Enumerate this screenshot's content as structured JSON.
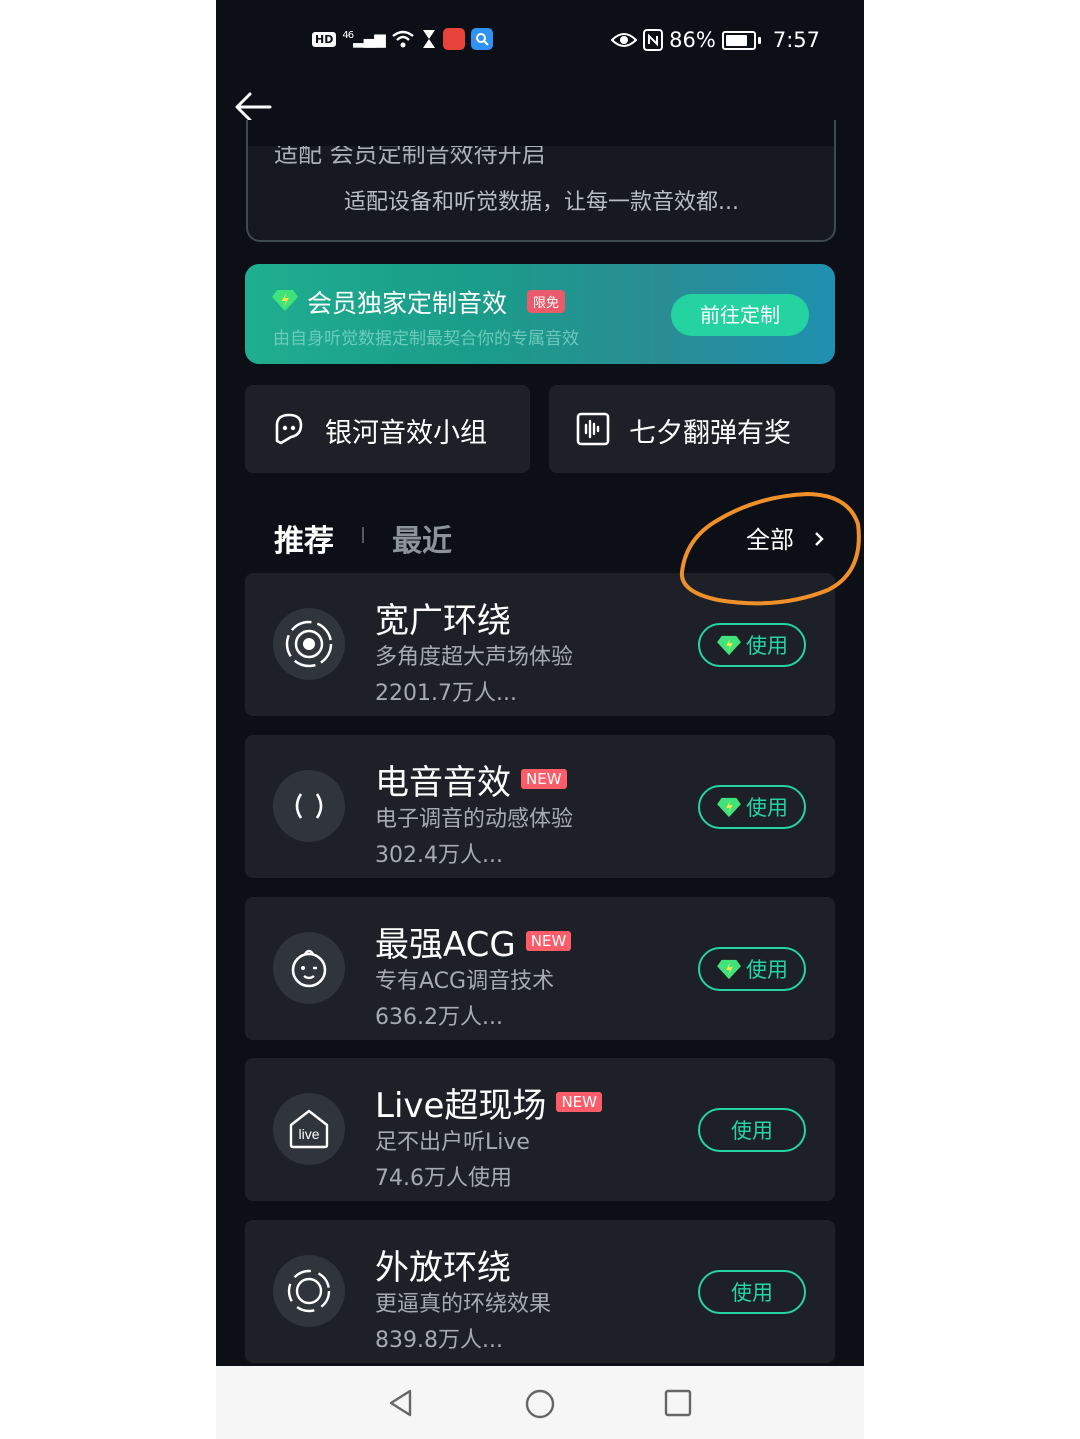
{
  "status_bar": {
    "hd": "HD",
    "network": "46",
    "battery_percent": "86%",
    "time": "7:57"
  },
  "adapt_card": {
    "title": "适配  会员定制音效待开启",
    "subtitle": "适配设备和听觉数据，让每一款音效都..."
  },
  "vip_banner": {
    "title": "会员独家定制音效",
    "badge": "限免",
    "subtitle": "由自身听觉数据定制最契合你的专属音效",
    "button": "前往定制"
  },
  "quick_links": [
    {
      "label": "银河音效小组",
      "icon": "group-chat-icon"
    },
    {
      "label": "七夕翻弹有奖",
      "icon": "audio-wave-icon"
    }
  ],
  "tabs": {
    "active": "推荐",
    "inactive": "最近",
    "all_label": "全部"
  },
  "effects": [
    {
      "title": "宽广环绕",
      "new": "",
      "desc": "多角度超大声场体验",
      "count": "2201.7万人...",
      "button": "使用",
      "vip": true,
      "icon": "surround-icon"
    },
    {
      "title": "电音音效",
      "new": "NEW",
      "desc": "电子调音的动感体验",
      "count": "302.4万人...",
      "button": "使用",
      "vip": true,
      "icon": "electronic-sound-icon"
    },
    {
      "title": "最强ACG",
      "new": "NEW",
      "desc": "专有ACG调音技术",
      "count": "636.2万人...",
      "button": "使用",
      "vip": true,
      "icon": "anime-face-icon"
    },
    {
      "title": "Live超现场",
      "new": "NEW",
      "desc": "足不出户听Live",
      "count": "74.6万人使用",
      "button": "使用",
      "vip": false,
      "icon": "live-house-icon",
      "icon_text": "live"
    },
    {
      "title": "外放环绕",
      "new": "",
      "desc": "更逼真的环绕效果",
      "count": "839.8万人...",
      "button": "使用",
      "vip": false,
      "icon": "speaker-surround-icon"
    }
  ],
  "colors": {
    "background": "#0d0f17",
    "card": "#1d2026",
    "accent": "#26d4a3",
    "new_badge": "#ff5c6a",
    "annotation": "#f0902a"
  }
}
